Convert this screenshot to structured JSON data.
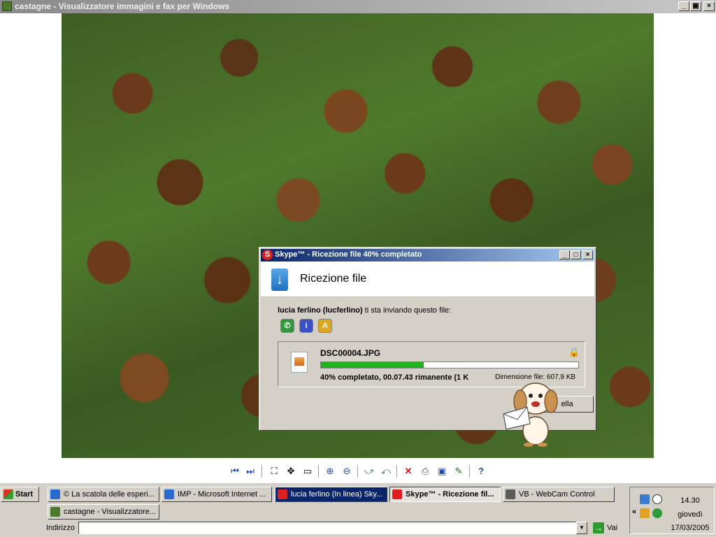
{
  "viewer": {
    "title": "castagne - Visualizzatore immagini e fax per Windows",
    "controls": {
      "minimize": "_",
      "maximize": "▣",
      "close": "×"
    },
    "toolbar": [
      "previous-image-icon",
      "next-image-icon",
      "best-fit-icon",
      "actual-size-icon",
      "slideshow-icon",
      "zoom-in-icon",
      "zoom-out-icon",
      "rotate-clockwise-icon",
      "rotate-counterclockwise-icon",
      "delete-icon",
      "print-icon",
      "save-icon",
      "edit-icon",
      "help-icon"
    ]
  },
  "skype_dialog": {
    "title": "Skype™ - Ricezione file 40% completato",
    "heading": "Ricezione file",
    "sender": "lucia ferlino (lucferlino)",
    "sender_suffix": " ti sta inviando questo file:",
    "file_name": "DSC00004.JPG",
    "progress_percent": 40,
    "progress_text": "40% completato, 00.07.43 rimanente  (1 K",
    "file_size": "Dimensione file: 607,9 KB",
    "cancel_label": "Annulla",
    "cancel_visible": "ella",
    "controls": {
      "minimize": "_",
      "maximize": "□",
      "close": "×"
    },
    "colors": {
      "progress": "#1fb31f",
      "title_start": "#0a246a"
    }
  },
  "taskbar": {
    "start_label": "Start",
    "tasks": [
      {
        "label": "© La scatola delle esperi...",
        "icon": "internet-explorer-icon"
      },
      {
        "label": "IMP - Microsoft Internet ...",
        "icon": "internet-explorer-icon"
      },
      {
        "label": "lucia ferlino (In linea) Sky...",
        "icon": "skype-icon"
      },
      {
        "label": "Skype™ - Ricezione fil...",
        "icon": "skype-icon"
      },
      {
        "label": "VB - WebCam Control",
        "icon": "vb-icon"
      },
      {
        "label": "castagne - Visualizzatore...",
        "icon": "image-viewer-icon"
      }
    ],
    "address_label": "Indirizzo",
    "address_value": "",
    "go_label": "Vai",
    "tray_toggle": "«",
    "clock": {
      "time": "14.30",
      "day": "giovedì",
      "date": "17/03/2005"
    }
  }
}
